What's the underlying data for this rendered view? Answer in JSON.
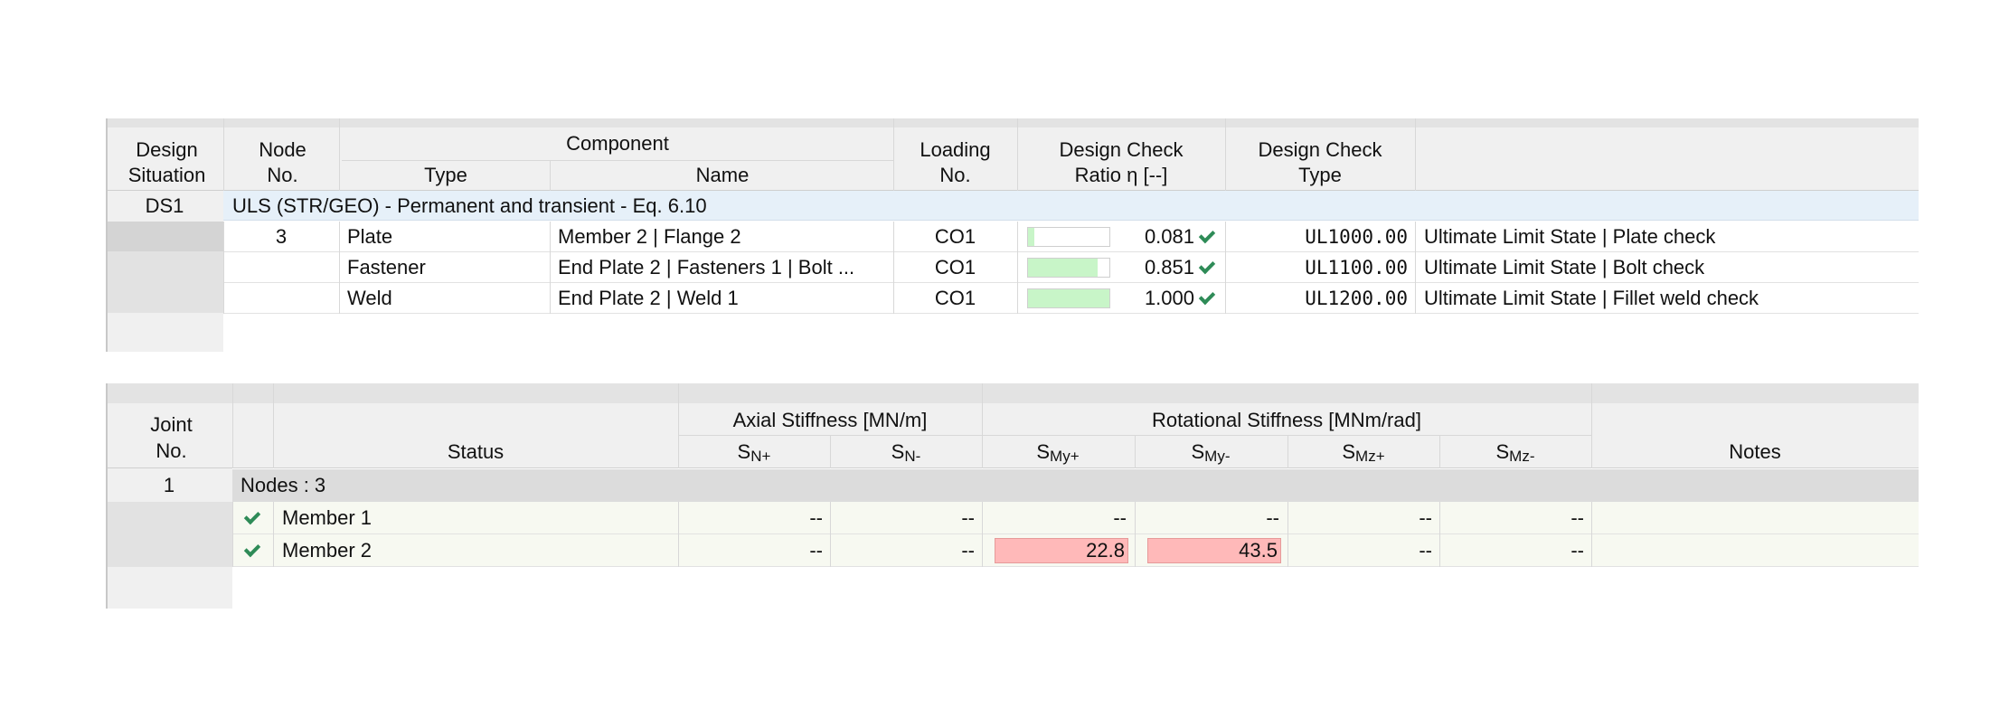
{
  "table1": {
    "headers": {
      "design_situation": "Design\nSituation",
      "node_no": "Node\nNo.",
      "component": "Component",
      "type": "Type",
      "name": "Name",
      "loading_no": "Loading\nNo.",
      "design_check_ratio": "Design Check\nRatio η [--]",
      "design_check_type": "Design Check\nType"
    },
    "group": {
      "situation": "DS1",
      "label": "ULS (STR/GEO) - Permanent and transient - Eq. 6.10"
    },
    "rows": [
      {
        "node": "3",
        "type": "Plate",
        "name": "Member 2 | Flange 2",
        "loading": "CO1",
        "ratio": "0.081",
        "ratio_value": 0.081,
        "check_code": "UL1000.00",
        "description": "Ultimate Limit State | Plate check"
      },
      {
        "node": "",
        "type": "Fastener",
        "name": "End Plate 2 | Fasteners 1 | Bolt ...",
        "loading": "CO1",
        "ratio": "0.851",
        "ratio_value": 0.851,
        "check_code": "UL1100.00",
        "description": "Ultimate Limit State | Bolt check"
      },
      {
        "node": "",
        "type": "Weld",
        "name": "End Plate 2 | Weld 1",
        "loading": "CO1",
        "ratio": "1.000",
        "ratio_value": 1.0,
        "check_code": "UL1200.00",
        "description": "Ultimate Limit State | Fillet weld check"
      }
    ],
    "colors": {
      "bar_fill": "#c8f5c8",
      "group_row_bg": "#e6f0f9",
      "check": "#2e8b57"
    }
  },
  "table2": {
    "headers": {
      "joint_no": "Joint\nNo.",
      "status": "Status",
      "axial_stiffness": "Axial Stiffness [MN/m]",
      "rotational_stiffness": "Rotational Stiffness [MNm/rad]",
      "notes": "Notes",
      "sub": [
        {
          "s": "S",
          "sub": "N+"
        },
        {
          "s": "S",
          "sub": "N-"
        },
        {
          "s": "S",
          "sub": "My+"
        },
        {
          "s": "S",
          "sub": "My-"
        },
        {
          "s": "S",
          "sub": "Mz+"
        },
        {
          "s": "S",
          "sub": "Mz-"
        }
      ]
    },
    "group": {
      "joint": "1",
      "label": "Nodes : 3"
    },
    "rows": [
      {
        "member": "Member 1",
        "values": [
          "--",
          "--",
          "--",
          "--",
          "--",
          "--"
        ],
        "highlight": [
          false,
          false,
          false,
          false,
          false,
          false
        ]
      },
      {
        "member": "Member 2",
        "values": [
          "--",
          "--",
          "22.8",
          "43.5",
          "--",
          "--"
        ],
        "highlight": [
          false,
          false,
          true,
          true,
          false,
          false
        ]
      }
    ],
    "colors": {
      "highlight": "#ffb9b9",
      "group_row_bg": "#dcdcdc",
      "row_bg": "#f7f9f1"
    }
  }
}
